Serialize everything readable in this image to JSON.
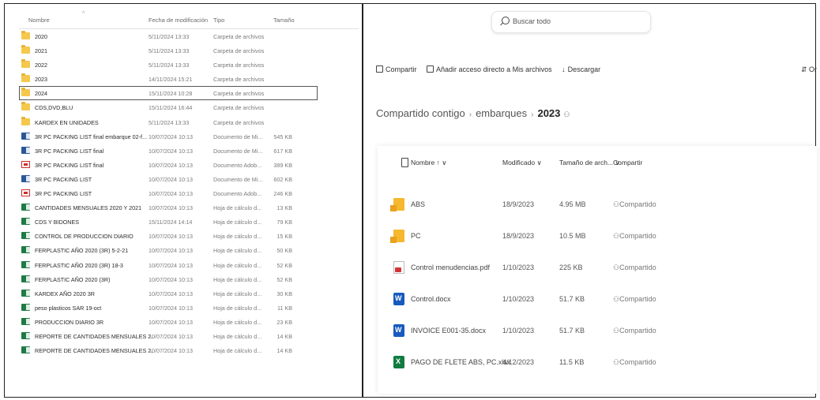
{
  "explorer": {
    "columns": {
      "name": "Nombre",
      "date": "Fecha de modificación",
      "type": "Tipo",
      "size": "Tamaño"
    },
    "rows": [
      {
        "name": "2020",
        "date": "5/11/2024 13:33",
        "type": "Carpeta de archivos",
        "size": "",
        "icon": "folder-icon"
      },
      {
        "name": "2021",
        "date": "5/11/2024 13:33",
        "type": "Carpeta de archivos",
        "size": "",
        "icon": "folder-icon"
      },
      {
        "name": "2022",
        "date": "5/11/2024 13:33",
        "type": "Carpeta de archivos",
        "size": "",
        "icon": "folder-icon"
      },
      {
        "name": "2023",
        "date": "14/11/2024 15:21",
        "type": "Carpeta de archivos",
        "size": "",
        "icon": "folder-icon"
      },
      {
        "name": "2024",
        "date": "15/11/2024 10:28",
        "type": "Carpeta de archivos",
        "size": "",
        "icon": "folder-icon",
        "selected": true
      },
      {
        "name": "CDS,DVD,BLU",
        "date": "15/11/2024 16:44",
        "type": "Carpeta de archivos",
        "size": "",
        "icon": "folder-icon"
      },
      {
        "name": "KARDEX EN UNIDADES",
        "date": "5/11/2024 13:33",
        "type": "Carpeta de archivos",
        "size": "",
        "icon": "folder-icon"
      },
      {
        "name": "3R PC PACKING LIST final embarque 02-f...",
        "date": "10/07/2024 10:13",
        "type": "Documento de Mi...",
        "size": "545 KB",
        "icon": "word-icon"
      },
      {
        "name": "3R PC PACKING LIST final",
        "date": "10/07/2024 10:13",
        "type": "Documento de Mi...",
        "size": "617 KB",
        "icon": "word-icon"
      },
      {
        "name": "3R PC PACKING LIST final",
        "date": "10/07/2024 10:13",
        "type": "Documento Adob...",
        "size": "389 KB",
        "icon": "pdf-icon"
      },
      {
        "name": "3R PC PACKING LIST",
        "date": "10/07/2024 10:13",
        "type": "Documento de Mi...",
        "size": "602 KB",
        "icon": "word-icon"
      },
      {
        "name": "3R PC PACKING LIST",
        "date": "10/07/2024 10:13",
        "type": "Documento Adob...",
        "size": "246 KB",
        "icon": "pdf-icon"
      },
      {
        "name": "CANTIDADES MENSUALES 2020 Y 2021",
        "date": "10/07/2024 10:13",
        "type": "Hoja de cálculo d...",
        "size": "13 KB",
        "icon": "excel-icon"
      },
      {
        "name": "CDS Y BIDONES",
        "date": "15/11/2024 14:14",
        "type": "Hoja de cálculo d...",
        "size": "79 KB",
        "icon": "excel-icon"
      },
      {
        "name": "CONTROL DE PRODUCCION DIARIO",
        "date": "10/07/2024 10:13",
        "type": "Hoja de cálculo d...",
        "size": "15 KB",
        "icon": "excel-icon"
      },
      {
        "name": "FERPLASTIC AÑO 2020 (3R) 5-2-21",
        "date": "10/07/2024 10:13",
        "type": "Hoja de cálculo d...",
        "size": "50 KB",
        "icon": "excel-icon"
      },
      {
        "name": "FERPLASTIC AÑO 2020 (3R) 18-3",
        "date": "10/07/2024 10:13",
        "type": "Hoja de cálculo d...",
        "size": "52 KB",
        "icon": "excel-icon"
      },
      {
        "name": "FERPLASTIC AÑO 2020 (3R)",
        "date": "10/07/2024 10:13",
        "type": "Hoja de cálculo d...",
        "size": "52 KB",
        "icon": "excel-icon"
      },
      {
        "name": "KARDEX AÑO 2020 3R",
        "date": "10/07/2024 10:13",
        "type": "Hoja de cálculo d...",
        "size": "30 KB",
        "icon": "excel-icon"
      },
      {
        "name": "peso plasticos SAR 19-oct",
        "date": "10/07/2024 10:13",
        "type": "Hoja de cálculo d...",
        "size": "11 KB",
        "icon": "excel-icon"
      },
      {
        "name": "PRODUCCION DIARIO 3R",
        "date": "10/07/2024 10:13",
        "type": "Hoja de cálculo d...",
        "size": "23 KB",
        "icon": "excel-icon"
      },
      {
        "name": "REPORTE DE CANTIDADES MENSUALES 2...",
        "date": "10/07/2024 10:13",
        "type": "Hoja de cálculo d...",
        "size": "14 KB",
        "icon": "excel-icon"
      },
      {
        "name": "REPORTE DE CANTIDADES MENSUALES 2...",
        "date": "10/07/2024 10:13",
        "type": "Hoja de cálculo d...",
        "size": "14 KB",
        "icon": "excel-icon"
      }
    ]
  },
  "onedrive": {
    "search_placeholder": "Buscar todo",
    "toolbar": {
      "share": "Compartir",
      "add_shortcut": "Añadir acceso directo a Mis archivos",
      "download": "Descargar",
      "sort": "Or"
    },
    "breadcrumb": {
      "root": "Compartido contigo",
      "middle": "embarques",
      "current": "2023"
    },
    "columns": {
      "name": "Nombre ↑ ∨",
      "modified": "Modificado ∨",
      "size": "Tamaño de arch... ∨",
      "share": "Compartir"
    },
    "files": [
      {
        "name": "ABS",
        "modified": "18/9/2023",
        "size": "4.95 MB",
        "share": "Compartido",
        "icon": "folder-icon"
      },
      {
        "name": "PC",
        "modified": "18/9/2023",
        "size": "10.5 MB",
        "share": "Compartido",
        "icon": "folder-icon"
      },
      {
        "name": "Control menudencias.pdf",
        "modified": "1/10/2023",
        "size": "225 KB",
        "share": "Compartido",
        "icon": "pdf-icon"
      },
      {
        "name": "Control.docx",
        "modified": "1/10/2023",
        "size": "51.7 KB",
        "share": "Compartido",
        "icon": "word-icon"
      },
      {
        "name": "INVOICE E001-35.docx",
        "modified": "1/10/2023",
        "size": "51.7 KB",
        "share": "Compartido",
        "icon": "word-icon"
      },
      {
        "name": "PAGO DE FLETE ABS, PC.xlsx",
        "modified": "4/12/2023",
        "size": "11.5 KB",
        "share": "Compartido",
        "icon": "excel-icon"
      }
    ]
  }
}
